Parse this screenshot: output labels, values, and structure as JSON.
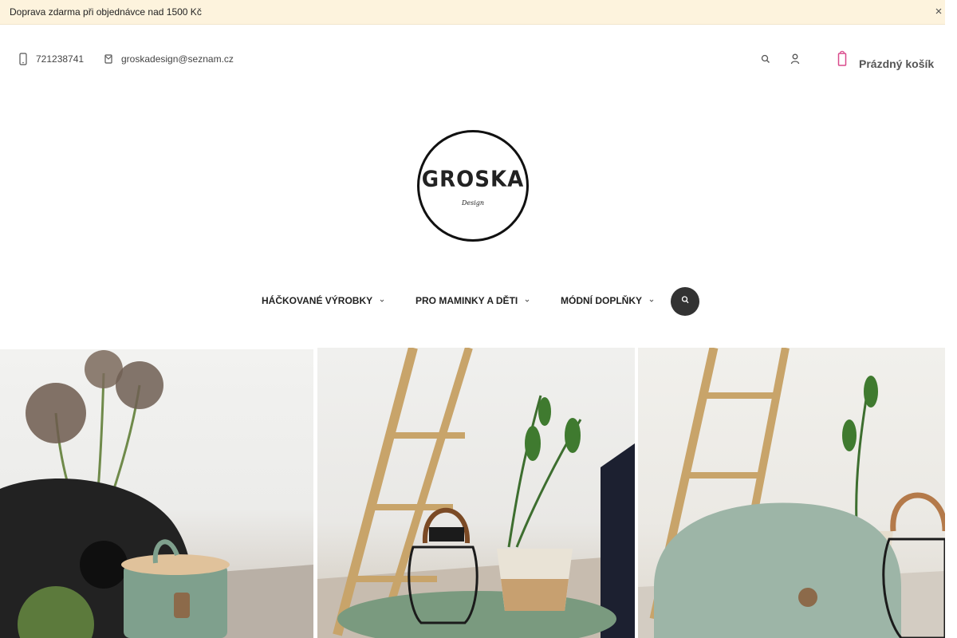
{
  "announcement": {
    "text": "Doprava zdarma při objednávce nad 1500 Kč",
    "close_icon": "close-icon"
  },
  "header": {
    "phone": "721238741",
    "email": "groskadesign@seznam.cz",
    "cart_label": "Prázdný košík",
    "icons": {
      "phone": "phone-icon",
      "email": "envelope-icon",
      "search": "search-icon",
      "user": "user-icon",
      "cart": "shopping-bag-icon"
    },
    "cart_icon_color": "#d94a8c"
  },
  "logo": {
    "brand": "GROSKA",
    "sub": "Design"
  },
  "nav": {
    "items": [
      {
        "label": "HÁČKOVANÉ VÝROBKY"
      },
      {
        "label": "PRO MAMINKY A DĚTI"
      },
      {
        "label": "MÓDNÍ DOPLŇKY"
      }
    ],
    "search_icon": "search-icon"
  },
  "colors": {
    "announcement_bg": "#fdf3dd",
    "nav_search_bg": "#333333"
  }
}
